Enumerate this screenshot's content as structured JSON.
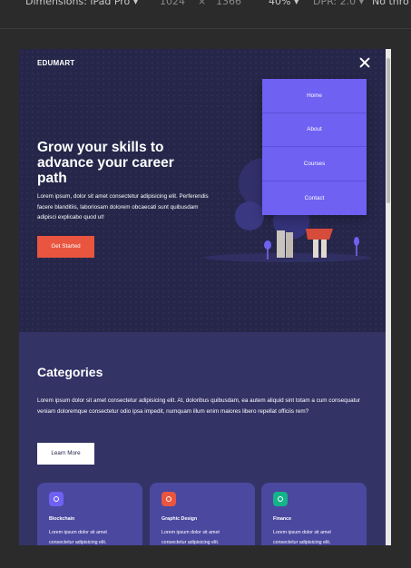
{
  "devtools": {
    "dimensions": "Dimensions: iPad Pro ▾",
    "width": "1024",
    "times": "×",
    "height": "1366",
    "zoom": "40% ▾",
    "dpr": "DPR: 2.0 ▾",
    "throttle": "No thro"
  },
  "header": {
    "logo": "EDUMART",
    "close_icon": "close-icon"
  },
  "menu": {
    "items": [
      "Home",
      "About",
      "Courses",
      "Contact"
    ]
  },
  "hero": {
    "title": "Grow your skills to advance your career path",
    "text": "Lorem ipsum, dolor sit amet consectetur adipisicing elit. Perferendis facere blanditiis, laboriosam dolorem obcaecati sunt quibusdam adipisci explicabo quod ut!",
    "cta": "Get Started"
  },
  "categories": {
    "title": "Categories",
    "text": "Lorem ipsum dolor sit amet consectetur adipisicing elit. At, doloribus quibusdam, ea autem aliquid sint totam a cum consequatur veniam doloremque consectetur odio ipsa impedit, numquam illum enim maiores libero repellat officiis rem?",
    "button": "Learn More",
    "cards": [
      {
        "title": "Blockchain",
        "desc": "Lorem ipsum dolor sit amet consectetur adipisicing elit.",
        "color": "#6f61f2",
        "icon": "blockchain-icon"
      },
      {
        "title": "Graphic Design",
        "desc": "Lorem ipsum dolor sit amet consectetur adipisicing elit.",
        "color": "#e9553f",
        "icon": "design-icon"
      },
      {
        "title": "Finance",
        "desc": "Lorem ipsum dolor sit amet consectetur adipisicing elit.",
        "color": "#14b38a",
        "icon": "finance-icon"
      }
    ]
  },
  "colors": {
    "accent": "#6f61f2",
    "cta": "#e9553f",
    "bg": "#252649",
    "card": "#4b48a0"
  }
}
